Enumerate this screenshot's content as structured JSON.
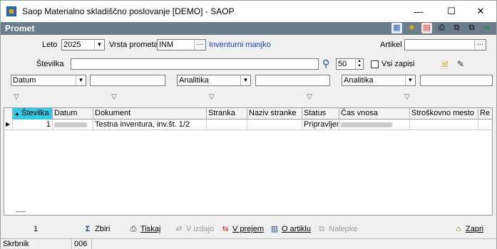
{
  "window": {
    "title": "Saop Materialno skladiščno poslovanje [DEMO] - SAOP",
    "minimize": "—",
    "maximize": "☐",
    "close": "✕"
  },
  "header": {
    "title": "Promet"
  },
  "filters": {
    "leto_label": "Leto",
    "leto_value": "2025",
    "vrsta_label": "Vrsta prometa",
    "vrsta_value": "INM",
    "vrsta_desc": "Inventurni manjko",
    "artikel_label": "Artikel",
    "artikel_value": "",
    "stevilka_label": "Številka",
    "stevilka_value": "",
    "limit_value": "50",
    "vsi_zapisi_label": "Vsi zapisi",
    "combo1": "Datum",
    "combo2": "Analitika",
    "combo3": "Analitika"
  },
  "grid": {
    "columns": [
      "Številka",
      "Datum",
      "Dokument",
      "Stranka",
      "Naziv stranke",
      "Status",
      "Čas vnosa",
      "Stroškovno mesto",
      "Re"
    ],
    "rows": [
      {
        "stevilka": "1",
        "dokument": "Testna inventura,  inv.št. 1/2",
        "stranka": "",
        "naziv": "",
        "status": "Pripravljen"
      }
    ]
  },
  "toolbar": {
    "count": "1",
    "zbiri": "Zbiri",
    "tiskaj": "Tiskaj",
    "v_izdajo": "V izdajo",
    "v_prejem": "V prejem",
    "o_artiklu": "O artiklu",
    "nalepke": "Nalepke",
    "zapri": "Zapri"
  },
  "status": {
    "user": "Skrbnik",
    "code": "006"
  }
}
